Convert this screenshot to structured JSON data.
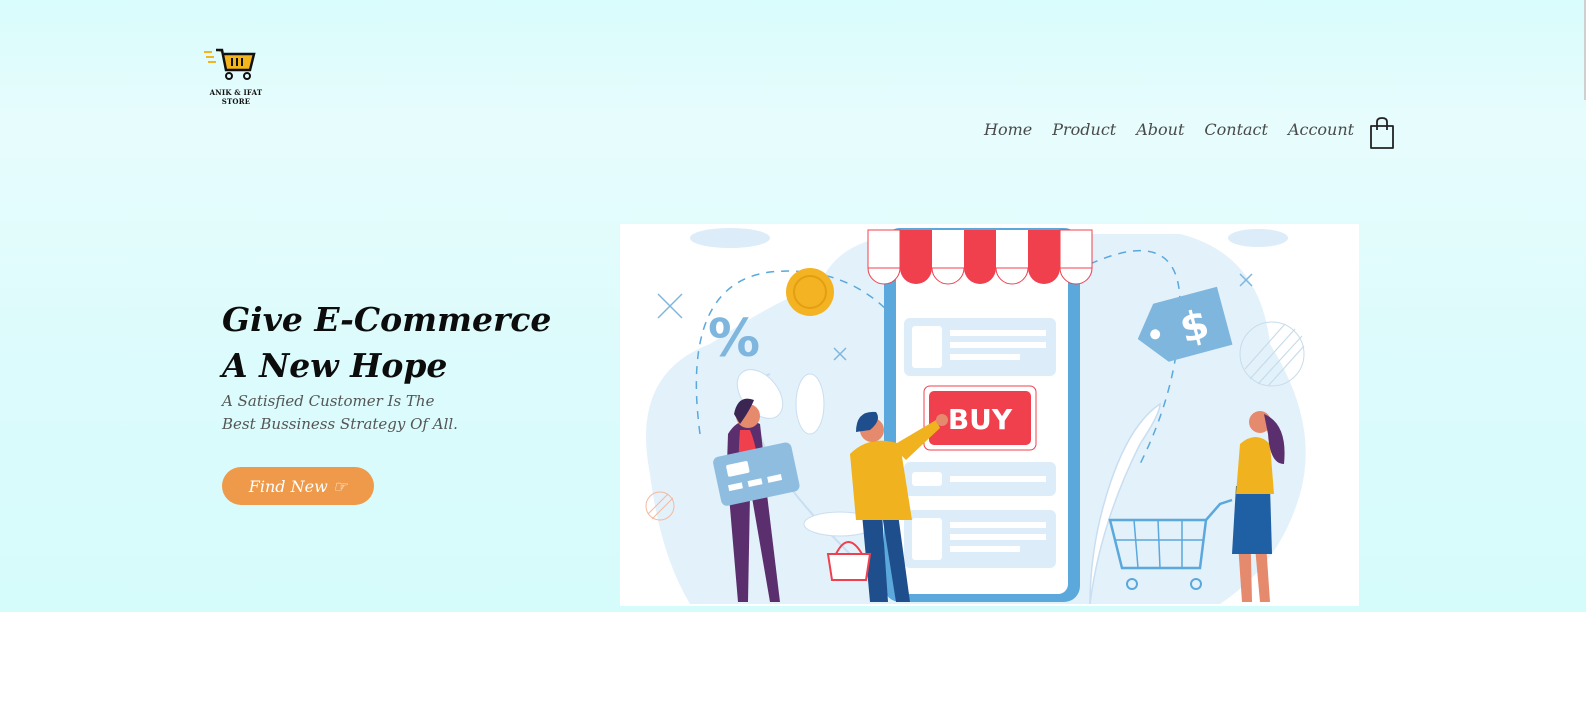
{
  "brand": {
    "logo_text": "ANIK & IFAT STORE",
    "logo_icon": "shopping-cart-icon"
  },
  "nav": {
    "items": [
      "Home",
      "Product",
      "About",
      "Contact",
      "Account"
    ],
    "cart_icon": "shopping-bag-icon"
  },
  "hero": {
    "headline_line1": "Give E-Commerce",
    "headline_line2": "A New Hope",
    "sub_line1": "A Satisfied Customer Is The",
    "sub_line2": "Best Bussiness Strategy Of All.",
    "cta_label": "Find New ☞"
  },
  "illustration": {
    "buy_label": "BUY",
    "percent_symbol": "%",
    "dollar_symbol": "$"
  },
  "colors": {
    "accent": "#ee9a4a",
    "buy_red": "#f0404e",
    "phone_blue": "#5aa8dc",
    "yellow": "#f0b21e"
  }
}
